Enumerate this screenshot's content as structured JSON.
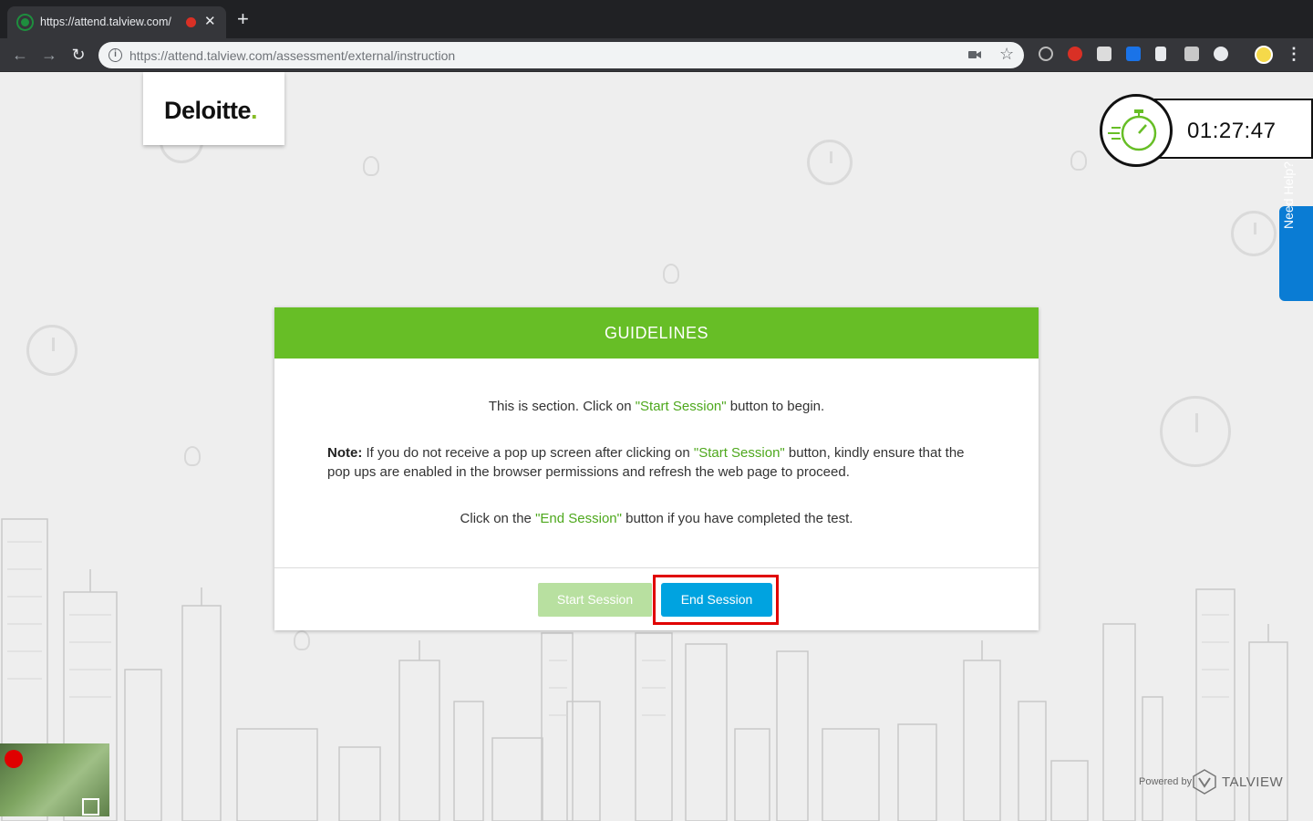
{
  "browser": {
    "tab_title": "https://attend.talview.com/",
    "url_host": "https://attend.talview.com",
    "url_path": "/assessment/external/instruction"
  },
  "brand": {
    "logo_text": "Deloitte",
    "logo_dot": ".",
    "accent": "#67be26",
    "button_blue": "#00a3e0"
  },
  "timer": {
    "value": "01:27:47"
  },
  "help": {
    "label": "Need Help?"
  },
  "modal": {
    "title": "GUIDELINES",
    "intro_a": "This is section. Click on ",
    "intro_link": "\"Start Session\"",
    "intro_b": " button to begin.",
    "note_label": "Note:",
    "note_a": " If you do not receive a pop up screen after clicking on ",
    "note_link": "\"Start Session\"",
    "note_b": " button, kindly ensure that the pop ups are enabled in the browser permissions and refresh the web page to proceed.",
    "end_a": "Click on the ",
    "end_link": "\"End Session\"",
    "end_b": " button if you have completed the test.",
    "start_button": "Start Session",
    "end_button": "End Session"
  },
  "footer": {
    "powered_by": "Powered by",
    "vendor": "TALVIEW"
  }
}
